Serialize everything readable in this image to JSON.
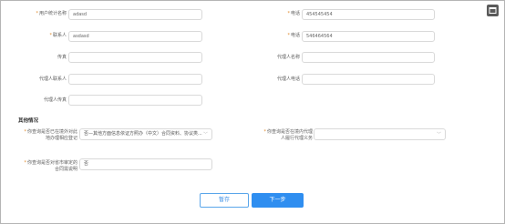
{
  "form": {
    "fields": [
      {
        "key": "user_name",
        "label": "用户统计名称",
        "required": true,
        "value": "adasd"
      },
      {
        "key": "phone",
        "label": "电话",
        "required": true,
        "value": "454545454"
      },
      {
        "key": "contact",
        "label": "联系人",
        "required": true,
        "value": "asdasd"
      },
      {
        "key": "tel",
        "label": "电话",
        "required": true,
        "value": "546464564"
      },
      {
        "key": "fax",
        "label": "传真",
        "required": false,
        "value": ""
      },
      {
        "key": "agent_name",
        "label": "代理人名称",
        "required": false,
        "value": ""
      },
      {
        "key": "agent_contact",
        "label": "代理人联系人",
        "required": false,
        "value": ""
      },
      {
        "key": "agent_tel",
        "label": "代理人电话",
        "required": false,
        "value": ""
      },
      {
        "key": "agent_fax",
        "label": "代理人传真",
        "required": false,
        "value": ""
      }
    ]
  },
  "other": {
    "section_title": "其他情况",
    "q1": {
      "label_line1": "你查询是否已在境外对此",
      "label_line2": "地办理相应登记",
      "value": "否—其他方面信息依证方照办（中文）合同资料、协议类...",
      "required": true
    },
    "q2": {
      "label_line1": "你查询是否在境内代理",
      "label_line2": "人履行代理义务",
      "value": "",
      "required": true
    },
    "q3": {
      "label_line1": "你查询是否对省市审定的",
      "label_line2": "合同需说明",
      "value": "否",
      "required": true
    }
  },
  "buttons": {
    "save": "暂存",
    "next": "下一步"
  },
  "icons": {
    "corner": "window-icon"
  }
}
